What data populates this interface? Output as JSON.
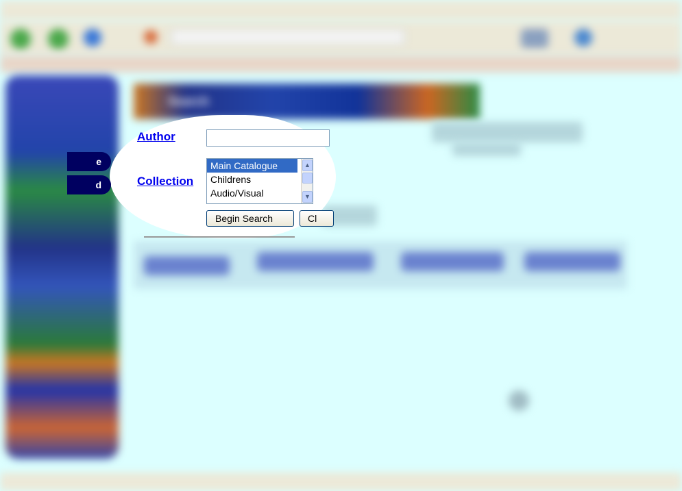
{
  "banner": {
    "title": "Search"
  },
  "sidebar": {
    "tab1_label": "e",
    "tab2_label": "d"
  },
  "form": {
    "author_label": "Author",
    "author_value": "",
    "collection_label": "Collection",
    "collection_options": [
      "Main Catalogue",
      "Childrens",
      "Audio/Visual"
    ],
    "collection_selected": "Main Catalogue",
    "begin_button": "Begin Search",
    "clear_button": "Cl"
  },
  "colors": {
    "page_bg": "#dcffff",
    "link": "#0000ee",
    "selection": "#316ac5",
    "sidebar_tab": "#000060"
  }
}
